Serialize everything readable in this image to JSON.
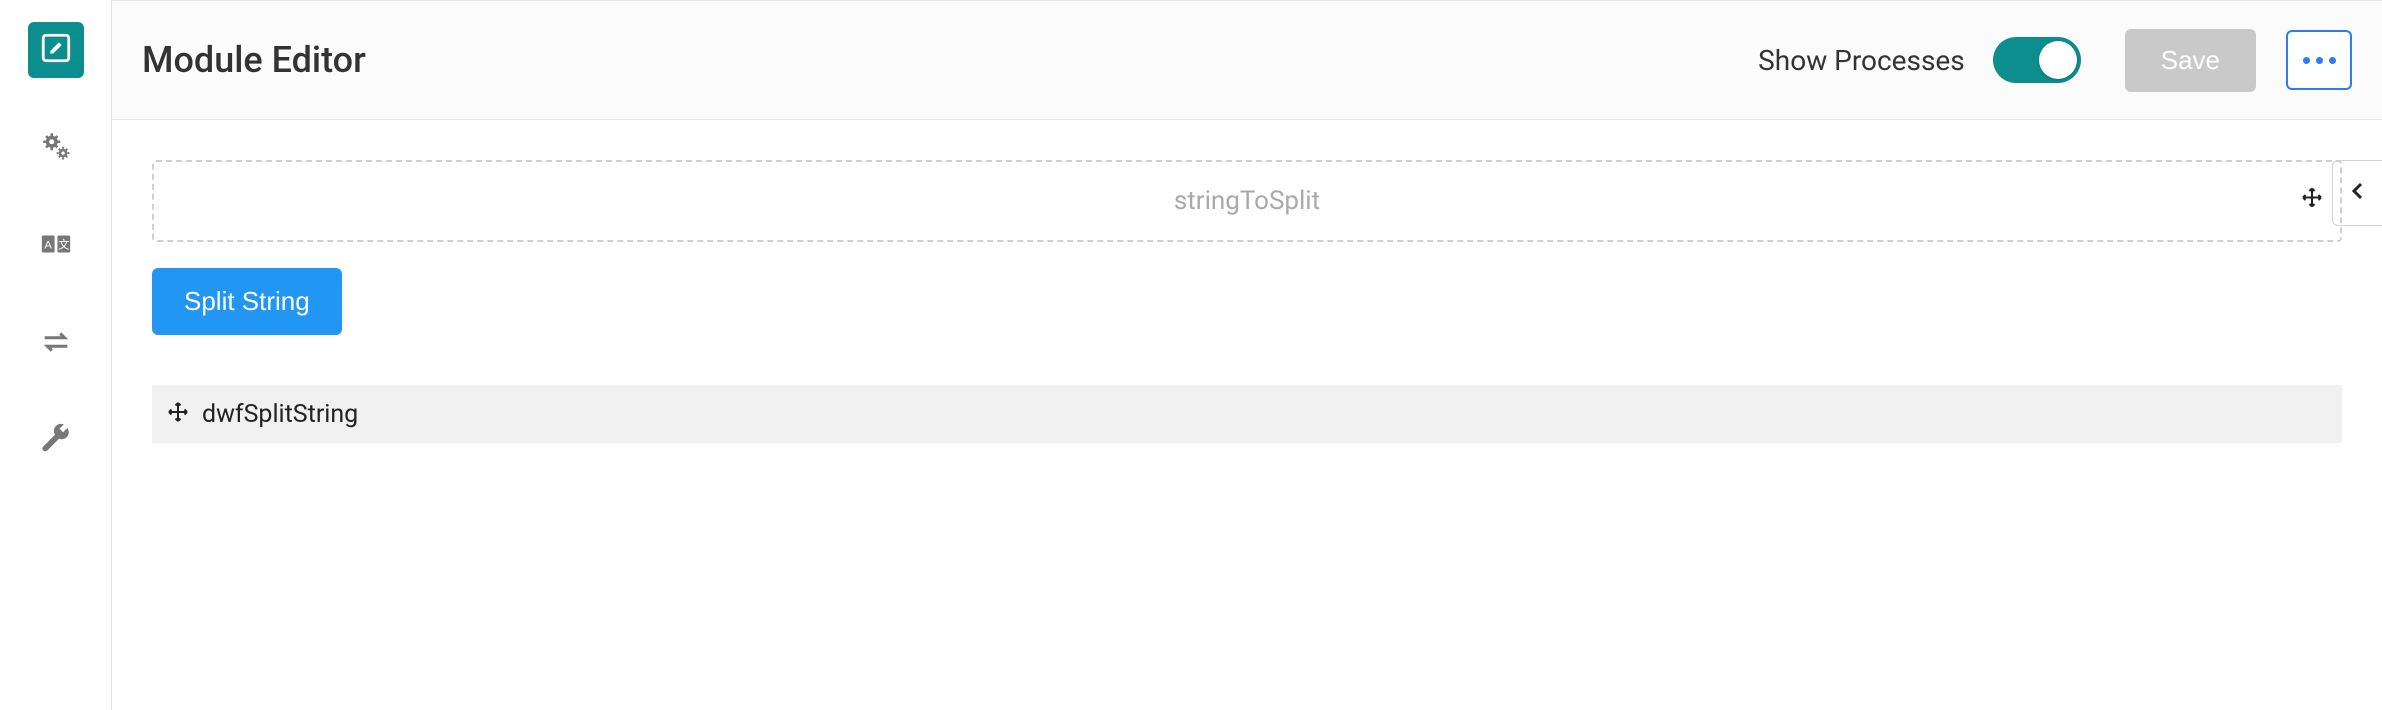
{
  "header": {
    "title": "Module Editor",
    "show_processes_label": "Show Processes",
    "show_processes_on": true,
    "save_label": "Save"
  },
  "editor": {
    "input_placeholder": "stringToSplit",
    "action_button": "Split String",
    "result_name": "dwfSplitString"
  }
}
